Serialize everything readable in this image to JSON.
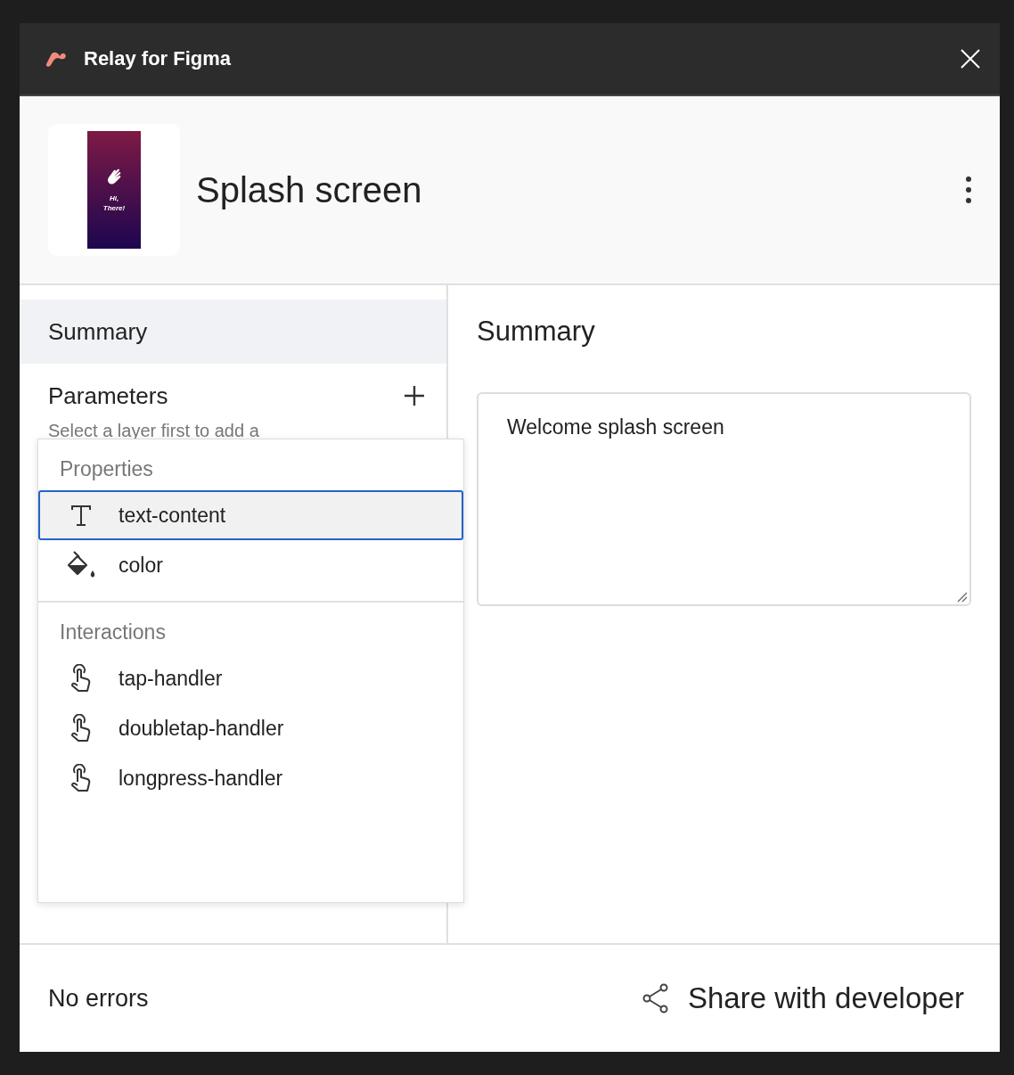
{
  "window": {
    "title": "Relay for Figma"
  },
  "component": {
    "name": "Splash screen",
    "thumbnail": {
      "lines": [
        "Hi,",
        "There!"
      ]
    }
  },
  "nav": [
    {
      "label": "Summary",
      "selected": true
    },
    {
      "label": "Parameters",
      "selected": false
    }
  ],
  "parameters_hint": "Select a layer first to add a",
  "summary": {
    "title": "Summary",
    "value": "Welcome splash screen"
  },
  "menu": {
    "sections": [
      {
        "title": "Properties",
        "items": [
          {
            "label": "text-content",
            "kind": "text",
            "selected": true
          },
          {
            "label": "color",
            "kind": "color",
            "selected": false
          }
        ]
      },
      {
        "title": "Interactions",
        "items": [
          {
            "label": "tap-handler",
            "kind": "touch",
            "selected": false
          },
          {
            "label": "doubletap-handler",
            "kind": "touch",
            "selected": false
          },
          {
            "label": "longpress-handler",
            "kind": "touch",
            "selected": false
          }
        ]
      }
    ]
  },
  "status": "No errors",
  "share_button": "Share with developer"
}
